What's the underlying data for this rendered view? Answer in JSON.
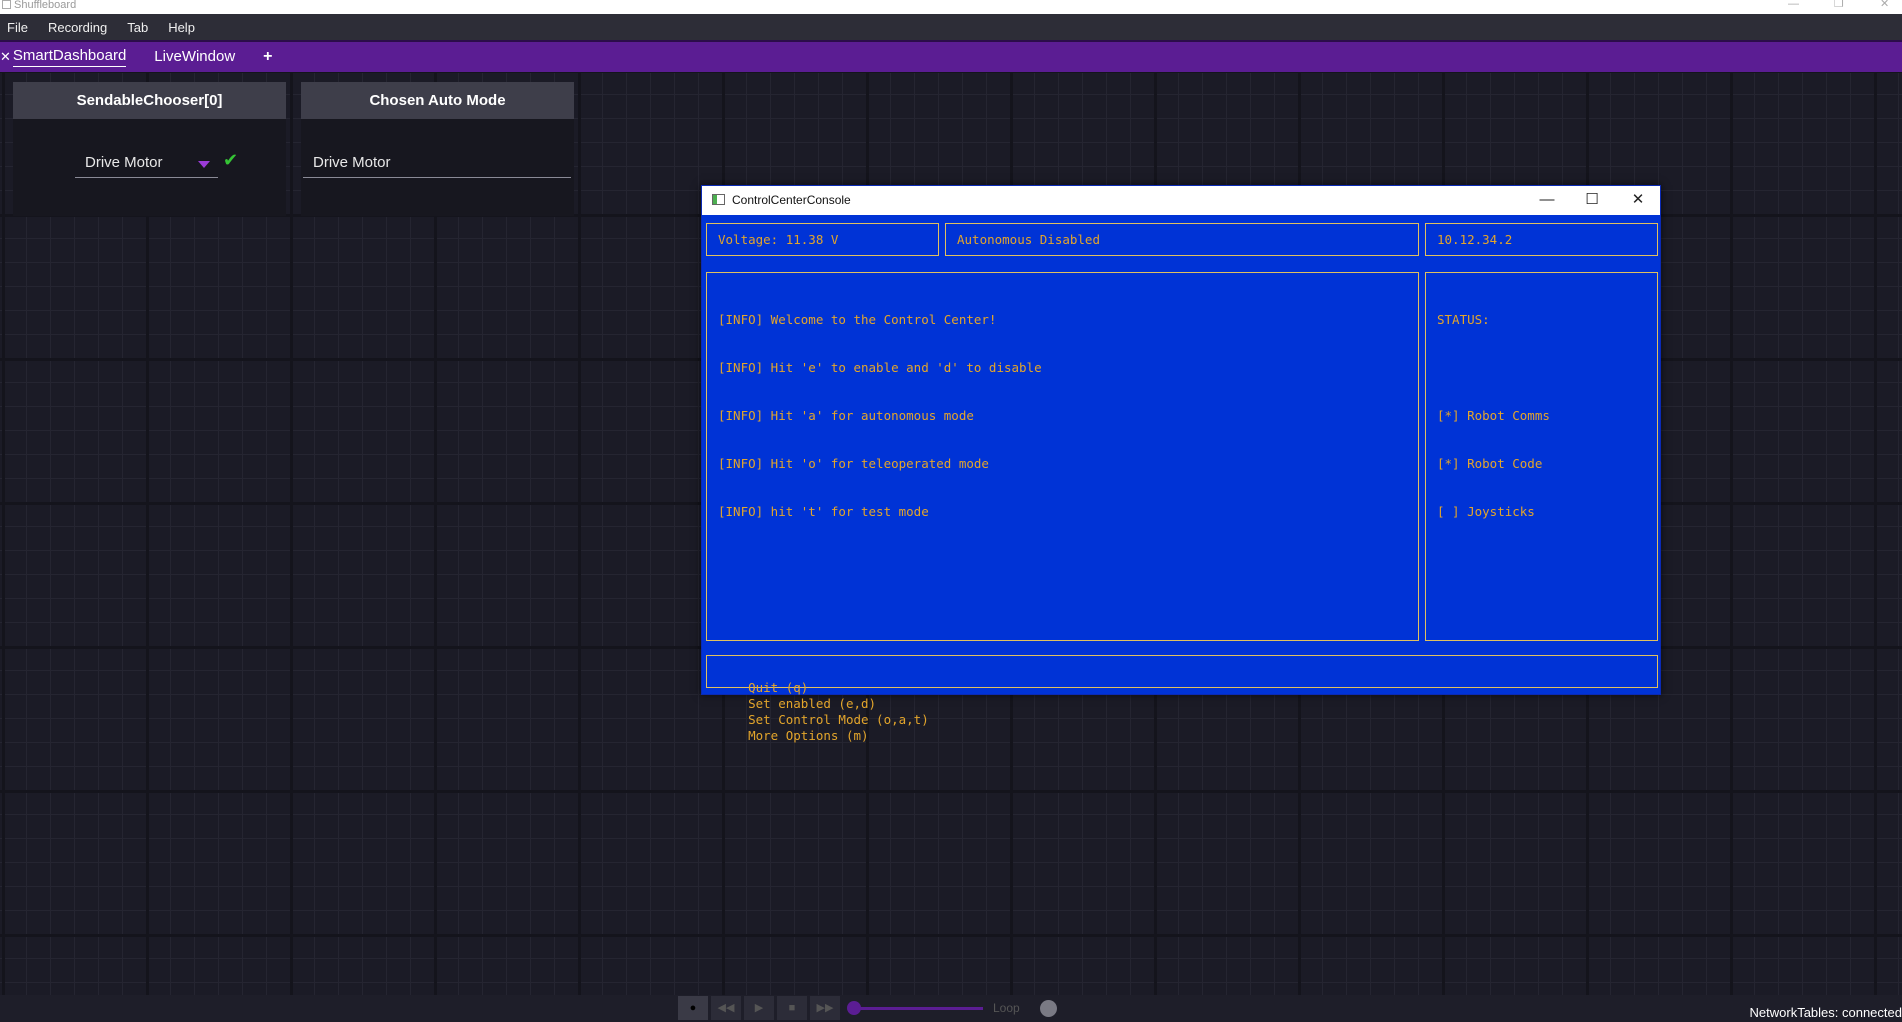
{
  "app": {
    "title": "Shuffleboard",
    "window_controls": [
      "—",
      "❐",
      "✕"
    ]
  },
  "menubar": {
    "items": [
      "File",
      "Recording",
      "Tab",
      "Help"
    ]
  },
  "tabs": {
    "close_glyph": "✕",
    "items": [
      "SmartDashboard",
      "LiveWindow"
    ],
    "add_glyph": "+"
  },
  "widgets": {
    "chooser": {
      "title": "SendableChooser[0]",
      "selected": "Drive Motor"
    },
    "chosen": {
      "title": "Chosen Auto Mode",
      "value": "Drive Motor"
    }
  },
  "console": {
    "title": "ControlCenterConsole",
    "controls": [
      "—",
      "☐",
      "✕"
    ],
    "voltage": "Voltage: 11.38 V",
    "mode": "Autonomous Disabled",
    "ip": "10.12.34.2",
    "log": [
      "[INFO] Welcome to the Control Center!",
      "[INFO] Hit 'e' to enable and 'd' to disable",
      "[INFO] Hit 'a' for autonomous mode",
      "[INFO] Hit 'o' for teleoperated mode",
      "[INFO] hit 't' for test mode"
    ],
    "status": {
      "heading": "STATUS:",
      "items": [
        "[*] Robot Comms",
        "[*] Robot Code",
        "[ ] Joysticks"
      ]
    },
    "commands": [
      "Quit (q)",
      "Set enabled (e,d)",
      "Set Control Mode (o,a,t)",
      "More Options (m)"
    ]
  },
  "bottombar": {
    "playback_glyphs": [
      "●",
      "◀◀",
      "▶",
      "■",
      "▶▶"
    ],
    "loop_label": "Loop",
    "networktables": "NetworkTables: connected"
  },
  "colors": {
    "tab_bar": "#5b1d93",
    "console_bg": "#0033d6",
    "console_text": "#e3a52b",
    "check": "#35c435"
  }
}
